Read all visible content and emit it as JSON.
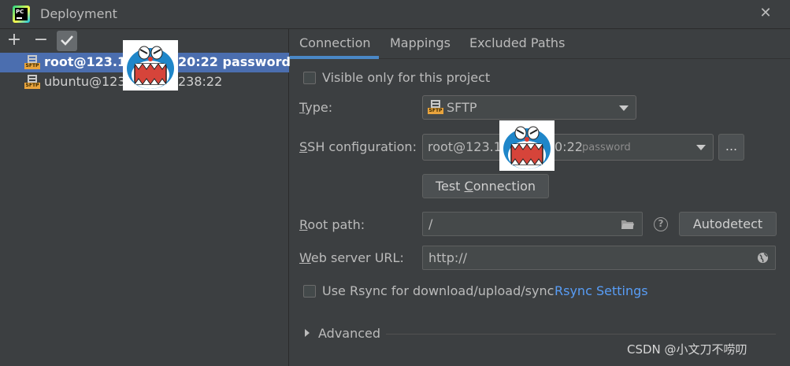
{
  "window": {
    "title": "Deployment"
  },
  "toolbar": {
    "add": "+",
    "remove": "−"
  },
  "servers": [
    {
      "name_prefix": "root@123.1",
      "name_suffix": "20:22 password",
      "selected": true
    },
    {
      "name_prefix": "ubuntu@123",
      "name_suffix": "238:22",
      "selected": false
    }
  ],
  "tabs": [
    "Connection",
    "Mappings",
    "Excluded Paths"
  ],
  "connection": {
    "visible_only": {
      "label": "Visible only for this project",
      "checked": false
    },
    "type": {
      "label_u": "T",
      "label_rest": "ype:",
      "value": "SFTP"
    },
    "ssh": {
      "label_u": "S",
      "label_rest": "SH configuration:",
      "value_prefix": "root@123.1",
      "value_suffix": "0:22",
      "value_hint": "password"
    },
    "ssh_more": "...",
    "test_button_pre": "Test ",
    "test_button_u": "C",
    "test_button_post": "onnection",
    "root_path": {
      "label_u": "R",
      "label_rest": "oot path:",
      "value": "/"
    },
    "help": "?",
    "autodetect": "Autodetect",
    "web_url": {
      "label_u": "W",
      "label_rest": "eb server URL:",
      "value": "http://"
    },
    "rsync": {
      "label": "Use Rsync for download/upload/sync",
      "checked": false,
      "link": "Rsync Settings"
    },
    "advanced": "Advanced"
  },
  "watermark": "CSDN @小文刀不唠叨",
  "colors": {
    "background": "#3c3f41",
    "selection": "#4b6eaf",
    "accent": "#4a88c7",
    "link": "#589df6",
    "sftp_tag": "#e8a33d"
  }
}
